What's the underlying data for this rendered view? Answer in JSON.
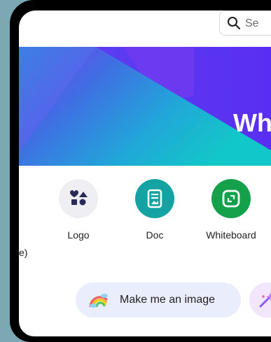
{
  "search": {
    "placeholder": "Se"
  },
  "banner": {
    "title": "Wh"
  },
  "design_types": [
    {
      "label": "Logo",
      "color": "#eeeef3",
      "icon": "shapes-icon"
    },
    {
      "label": "Doc",
      "color": "#15a2a2",
      "icon": "document-icon"
    },
    {
      "label": "Whiteboard",
      "color": "#15a04c",
      "icon": "whiteboard-icon"
    }
  ],
  "truncated_label": "e)",
  "prompts": [
    {
      "label": "Make me an image",
      "icon": "rainbow-icon"
    },
    {
      "label": "",
      "icon": "sparkle-wand-icon"
    }
  ]
}
